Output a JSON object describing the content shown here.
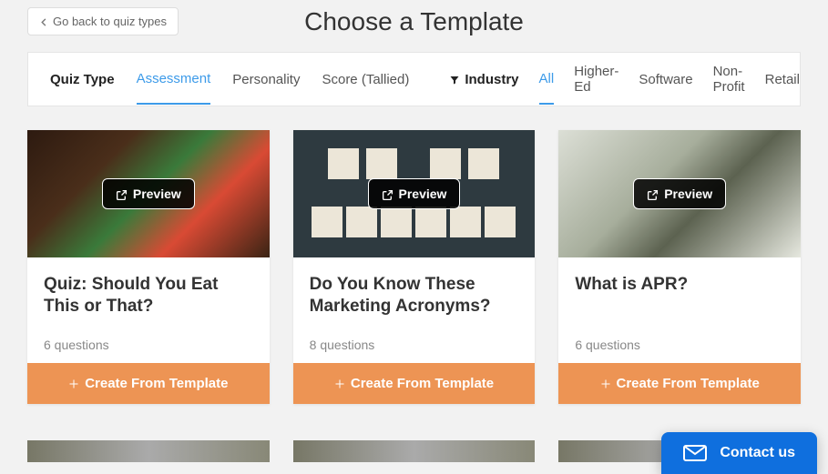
{
  "header": {
    "back_label": "Go back to quiz types",
    "title": "Choose a Template"
  },
  "filters": {
    "quiz_type_label": "Quiz Type",
    "quiz_types": [
      "Assessment",
      "Personality",
      "Score (Tallied)"
    ],
    "quiz_type_active": "Assessment",
    "industry_label": "Industry",
    "industries": [
      "All",
      "Higher-Ed",
      "Software",
      "Non-Profit",
      "Retail"
    ],
    "industry_active": "All"
  },
  "preview_label": "Preview",
  "create_label": "Create From Template",
  "cards": [
    {
      "title": "Quiz: Should You Eat This or That?",
      "meta": "6 questions"
    },
    {
      "title": "Do You Know These Marketing Acronyms?",
      "meta": "8 questions"
    },
    {
      "title": "What is APR?",
      "meta": "6 questions"
    }
  ],
  "contact": {
    "label": "Contact us"
  }
}
